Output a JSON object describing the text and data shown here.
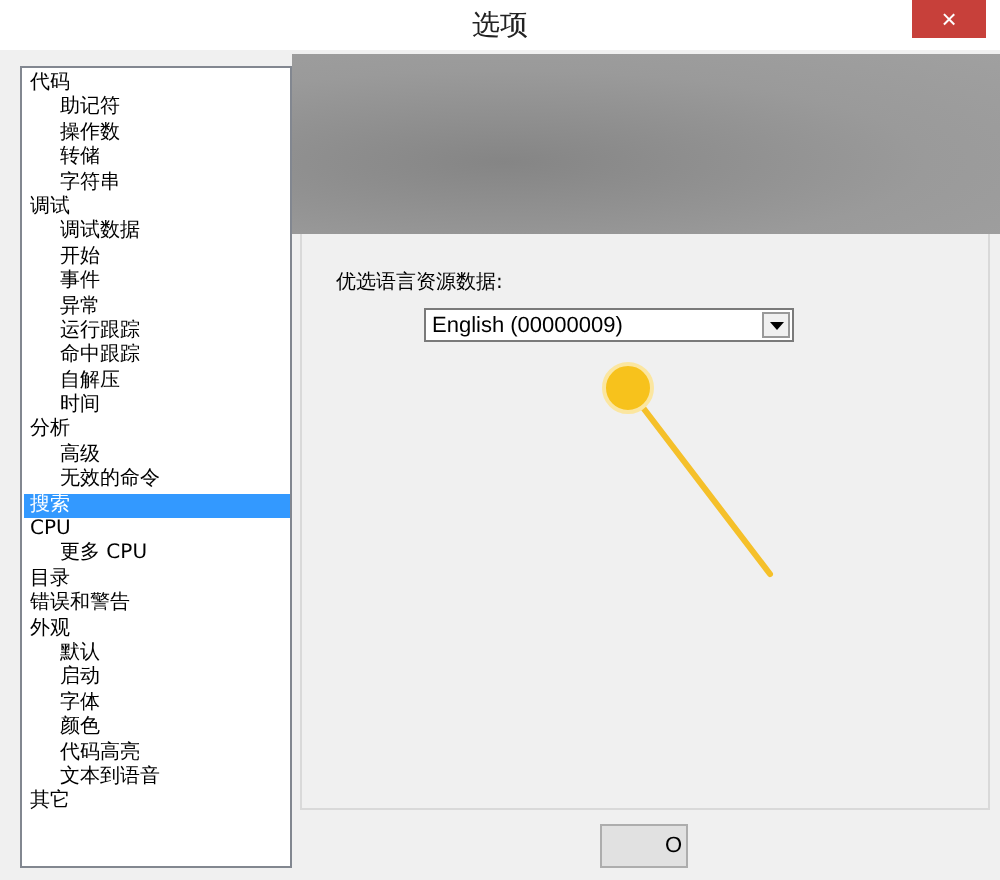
{
  "window": {
    "title": "选项",
    "close": "×"
  },
  "sidebar": {
    "items": [
      {
        "label": "代码",
        "selected": false,
        "children": [
          {
            "label": "助记符",
            "selected": false
          },
          {
            "label": "操作数",
            "selected": false
          },
          {
            "label": "转储",
            "selected": false
          },
          {
            "label": "字符串",
            "selected": false
          }
        ]
      },
      {
        "label": "调试",
        "selected": false,
        "children": [
          {
            "label": "调试数据",
            "selected": false
          },
          {
            "label": "开始",
            "selected": false
          },
          {
            "label": "事件",
            "selected": false
          },
          {
            "label": "异常",
            "selected": false
          },
          {
            "label": "运行跟踪",
            "selected": false
          },
          {
            "label": "命中跟踪",
            "selected": false
          },
          {
            "label": "自解压",
            "selected": false
          },
          {
            "label": "时间",
            "selected": false
          }
        ]
      },
      {
        "label": "分析",
        "selected": false,
        "children": [
          {
            "label": "高级",
            "selected": false
          },
          {
            "label": "无效的命令",
            "selected": false
          }
        ]
      },
      {
        "label": "搜索",
        "selected": true
      },
      {
        "label": "CPU",
        "selected": false,
        "children": [
          {
            "label": "更多 CPU",
            "selected": false
          }
        ]
      },
      {
        "label": "目录",
        "selected": false
      },
      {
        "label": "错误和警告",
        "selected": false
      },
      {
        "label": "外观",
        "selected": false,
        "children": [
          {
            "label": "默认",
            "selected": false
          },
          {
            "label": "启动",
            "selected": false
          },
          {
            "label": "字体",
            "selected": false
          },
          {
            "label": "颜色",
            "selected": false
          },
          {
            "label": "代码高亮",
            "selected": false
          },
          {
            "label": "文本到语音",
            "selected": false
          }
        ]
      },
      {
        "label": "其它",
        "selected": false
      }
    ]
  },
  "panel": {
    "language_label": "优选语言资源数据:",
    "language_value": "English (00000009)"
  },
  "buttons": [
    "O"
  ]
}
